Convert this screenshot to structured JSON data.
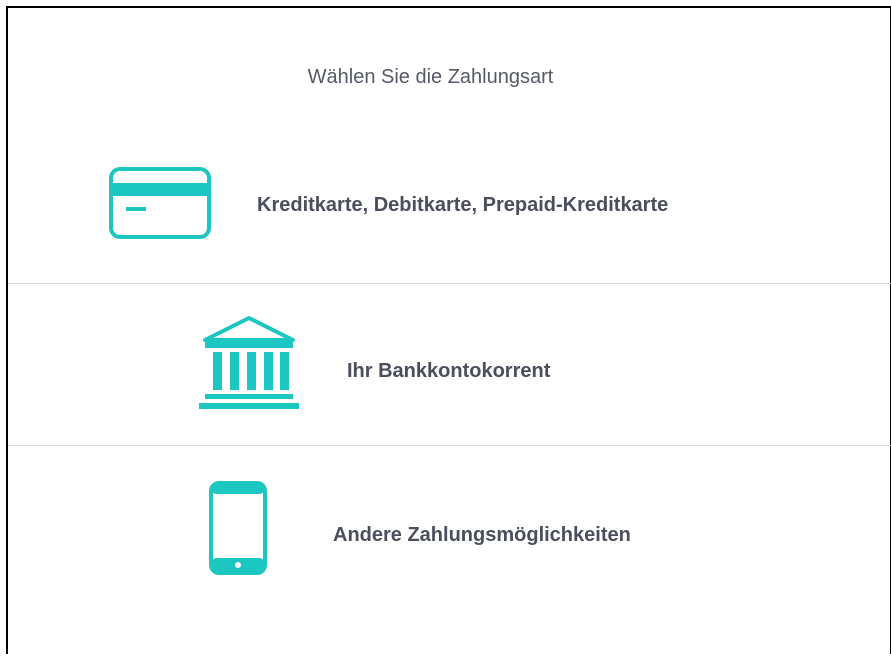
{
  "heading": "Wählen Sie die Zahlungsart",
  "options": [
    {
      "label": "Kreditkarte, Debitkarte, Prepaid-Kreditkarte",
      "icon": "credit-card-icon"
    },
    {
      "label": "Ihr Bankkontokorrent",
      "icon": "bank-icon"
    },
    {
      "label": "Andere Zahlungsmöglichkeiten",
      "icon": "mobile-phone-icon"
    }
  ],
  "colors": {
    "accent": "#1cc6c1",
    "text": "#4b4f5c",
    "heading": "#555a66",
    "divider": "#dcdcdc"
  }
}
